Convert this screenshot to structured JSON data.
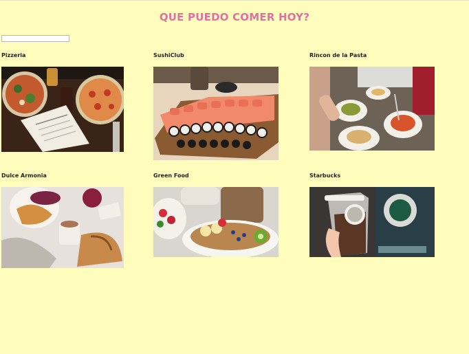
{
  "page": {
    "title": "QUE PUEDO COMER HOY?",
    "search": {
      "value": "",
      "placeholder": ""
    }
  },
  "restaurants": [
    {
      "name": "Pizzeria",
      "photo": "pizza-table-photo"
    },
    {
      "name": "SushiClub",
      "photo": "sushi-platter-photo"
    },
    {
      "name": "Rincon de la Pasta",
      "photo": "pasta-dishes-photo"
    },
    {
      "name": "Dulce Armonia",
      "photo": "croissants-coffee-photo"
    },
    {
      "name": "Green Food",
      "photo": "fruit-granola-bowl-photo"
    },
    {
      "name": "Starbucks",
      "photo": "starbucks-iced-drink-photo"
    }
  ]
}
